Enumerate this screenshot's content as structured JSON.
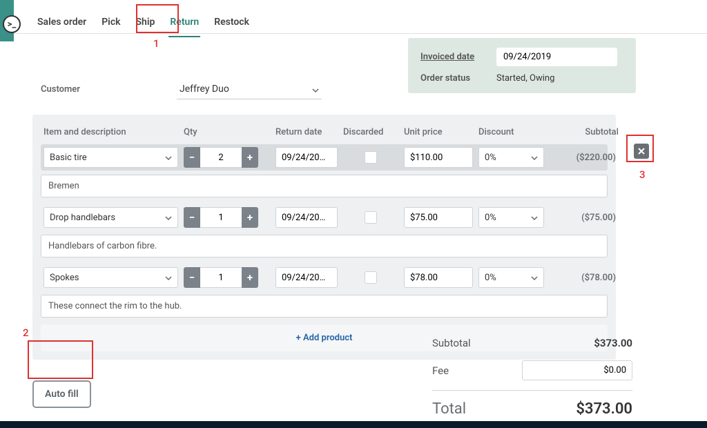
{
  "logo_text": ">_",
  "tabs": [
    "Sales order",
    "Pick",
    "Ship",
    "Return",
    "Restock"
  ],
  "active_tab_index": 3,
  "info": {
    "invoiced_label": "Invoiced date",
    "invoiced_value": "09/24/2019",
    "status_label": "Order status",
    "status_value": "Started, Owing"
  },
  "customer_label": "Customer",
  "customer_value": "Jeffrey Duo",
  "columns": [
    "Item and description",
    "Qty",
    "Return date",
    "Discarded",
    "Unit price",
    "Discount",
    "Subtotal"
  ],
  "rows": [
    {
      "item": "Basic tire",
      "qty": "2",
      "return_date": "09/24/20…",
      "unit_price": "$110.00",
      "discount": "0%",
      "subtotal": "($220.00)",
      "description": "Bremen",
      "highlighted": true
    },
    {
      "item": "Drop handlebars",
      "qty": "1",
      "return_date": "09/24/20…",
      "unit_price": "$75.00",
      "discount": "0%",
      "subtotal": "($75.00)",
      "description": "Handlebars of carbon fibre.",
      "highlighted": false
    },
    {
      "item": "Spokes",
      "qty": "1",
      "return_date": "09/24/20…",
      "unit_price": "$78.00",
      "discount": "0%",
      "subtotal": "($78.00)",
      "description": "These connect the rim to the hub.",
      "highlighted": false
    }
  ],
  "add_product_label": "+ Add product",
  "auto_fill_label": "Auto fill",
  "totals": {
    "subtotal_label": "Subtotal",
    "subtotal_value": "$373.00",
    "fee_label": "Fee",
    "fee_value": "$0.00",
    "total_label": "Total",
    "total_value": "$373.00"
  },
  "annotations": {
    "a1": "1",
    "a2": "2",
    "a3": "3"
  }
}
